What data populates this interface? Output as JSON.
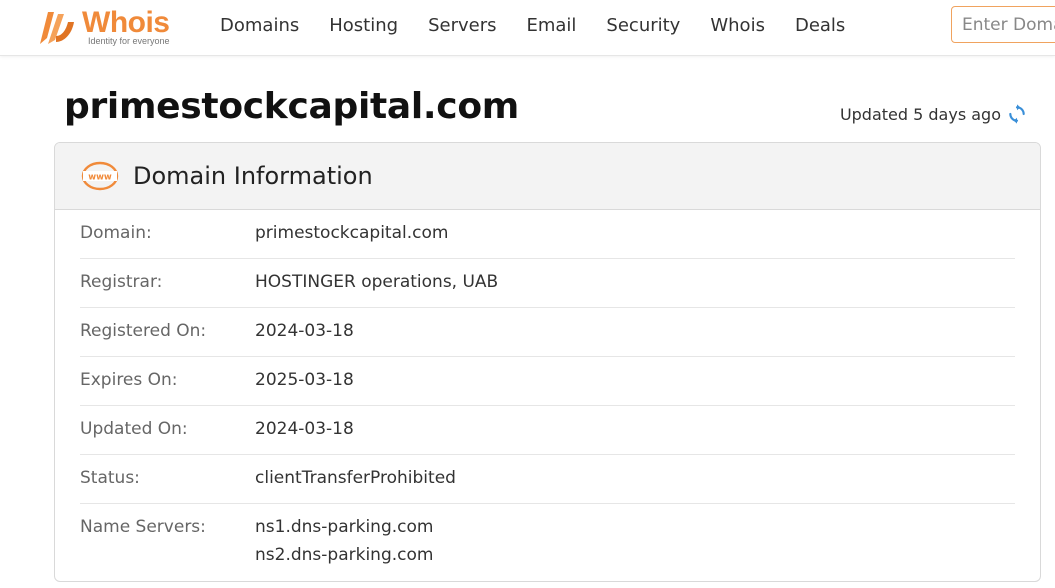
{
  "brand": {
    "name": "Whois",
    "tagline": "Identity for everyone",
    "color": "#f08a3a"
  },
  "nav": {
    "items": [
      "Domains",
      "Hosting",
      "Servers",
      "Email",
      "Security",
      "Whois",
      "Deals"
    ]
  },
  "search": {
    "placeholder": "Enter Domain"
  },
  "page": {
    "domain": "primestockcapital.com",
    "updated": "Updated 5 days ago"
  },
  "card": {
    "title": "Domain Information",
    "rows": [
      {
        "label": "Domain:",
        "value": "primestockcapital.com"
      },
      {
        "label": "Registrar:",
        "value": "HOSTINGER operations, UAB"
      },
      {
        "label": "Registered On:",
        "value": "2024-03-18"
      },
      {
        "label": "Expires On:",
        "value": "2025-03-18"
      },
      {
        "label": "Updated On:",
        "value": "2024-03-18"
      },
      {
        "label": "Status:",
        "value": "clientTransferProhibited"
      },
      {
        "label": "Name Servers:",
        "values": [
          "ns1.dns-parking.com",
          "ns2.dns-parking.com"
        ]
      }
    ]
  },
  "icons": {
    "logo": "whois-logo-icon",
    "refresh": "refresh-icon",
    "www": "www-icon"
  }
}
